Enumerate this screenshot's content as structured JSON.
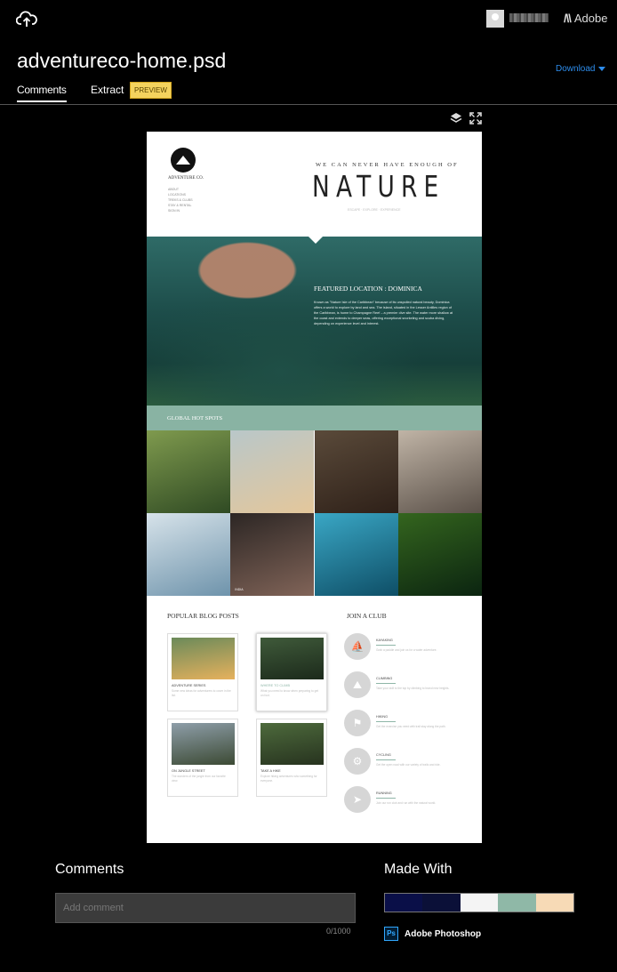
{
  "header": {
    "file_name": "adventureco-home.psd",
    "adobe_label": "Adobe",
    "download_label": "Download"
  },
  "tabs": [
    {
      "label": "Comments",
      "active": true
    },
    {
      "label": "Extract",
      "active": false
    }
  ],
  "preview_badge": "PREVIEW",
  "icons": [
    "cloud-upload-icon",
    "user-avatar",
    "adobe-logo-icon",
    "layers-icon",
    "fullscreen-icon",
    "photoshop-icon"
  ],
  "artboard": {
    "brand": "ADVENTURE CO.",
    "nav": [
      "ABOUT",
      "LOCATIONS",
      "TREKS & CLUBS",
      "STAY & RENTAL",
      "SIGN IN"
    ],
    "tagline": "WE CAN NEVER HAVE ENOUGH OF",
    "headline": "NATURE",
    "sub_tagline": "ESCAPE · EXPLORE · EXPERIENCE",
    "featured_title": "FEATURED LOCATION : DOMINICA",
    "featured_text": "Known as \"Nature Isle of the Caribbean\" because of its unspoiled natural beauty, Dominica offers a world to explore by land and sea. The island, situated in the Lesser Antilles region of the Caribbean, is home to Champagne Reef – a premier dive site. The water more shallow at the coast and extends to deeper seas, offering exceptional snorkeling and scuba diving, depending on experience level and interest.",
    "hotspots_title": "GLOBAL HOT SPOTS",
    "photos": [
      {
        "caption": "",
        "colors": [
          "#7f9a4e",
          "#2f4a23"
        ]
      },
      {
        "caption": "",
        "colors": [
          "#b9c7c9",
          "#e4c79b"
        ]
      },
      {
        "caption": "",
        "colors": [
          "#5a4a3a",
          "#2e2018"
        ]
      },
      {
        "caption": "",
        "colors": [
          "#c0b4a6",
          "#5a5048"
        ]
      },
      {
        "caption": "",
        "colors": [
          "#d7e3ea",
          "#6e93ab"
        ]
      },
      {
        "caption": "INDIA",
        "colors": [
          "#2c2624",
          "#816458"
        ]
      },
      {
        "caption": "",
        "colors": [
          "#3aa7c5",
          "#0e4e66"
        ]
      },
      {
        "caption": "",
        "colors": [
          "#34651e",
          "#0b2410"
        ]
      }
    ],
    "blog_title": "POPULAR BLOG POSTS",
    "blog_posts": [
      {
        "title": "ADVENTURE SERIES",
        "text": "Some new ideas for adventurers to cover in the list.",
        "colors": [
          "#6b8a5a",
          "#e6b15d"
        ]
      },
      {
        "title": "WHERE TO CLIMB",
        "text": "What you need to know when preparing to get on foot.",
        "colors": [
          "#3f5a3a",
          "#1c2a1b"
        ]
      },
      {
        "title": "ON JUNGLE STREET",
        "text": "The wonders of the jungle from our favorite view.",
        "colors": [
          "#8e9ea9",
          "#3c4a34"
        ]
      },
      {
        "title": "TAKE A HIKE",
        "text": "Explore hiking adventures who something for everyone.",
        "colors": [
          "#4d6a3c",
          "#27331f"
        ]
      }
    ],
    "club_title": "JOIN A CLUB",
    "clubs": [
      {
        "name": "KAYAKING",
        "desc": "Grab a paddle and join us for a water adventure.",
        "glyph": "⛵"
      },
      {
        "name": "CLIMBING",
        "desc": "Take your skill to the top by climbing to brand new heights.",
        "glyph": "⛰"
      },
      {
        "name": "HIKING",
        "desc": "Get the exercise you need with trail stay along the path.",
        "glyph": "⚑"
      },
      {
        "name": "CYCLING",
        "desc": "Get the open road with our variety of trails and ride.",
        "glyph": "⚙"
      },
      {
        "name": "RUNNING",
        "desc": "Join our run club and run with the natural world.",
        "glyph": "➤"
      }
    ]
  },
  "comments": {
    "heading": "Comments",
    "placeholder": "Add comment",
    "counter": "0/1000"
  },
  "made_with": {
    "heading": "Made With",
    "swatches": [
      "#0a0f48",
      "#0b1038",
      "#f4f4f4",
      "#8fb8a7",
      "#f7dab6"
    ],
    "app": "Adobe Photoshop",
    "app_badge": "Ps"
  }
}
